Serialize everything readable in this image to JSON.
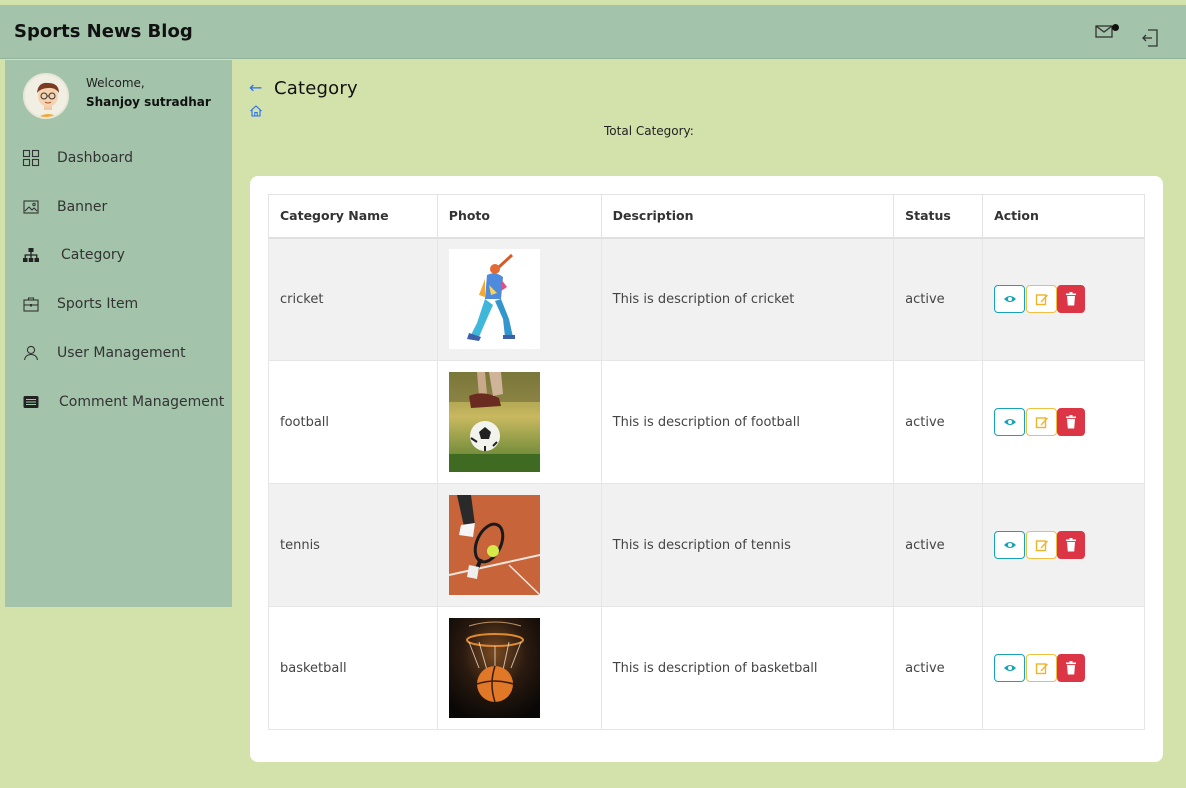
{
  "header": {
    "brand": "Sports News Blog",
    "icons": {
      "mail": "mail-icon",
      "notification": "notification-dot",
      "logout": "logout-icon"
    }
  },
  "sidebar": {
    "welcome": "Welcome,",
    "username": "Shanjoy sutradhar",
    "items": [
      {
        "label": "Dashboard",
        "icon": "dashboard-icon"
      },
      {
        "label": "Banner",
        "icon": "image-icon"
      },
      {
        "label": "Category",
        "icon": "sitemap-icon"
      },
      {
        "label": "Sports Item",
        "icon": "briefcase-icon"
      },
      {
        "label": "User Management",
        "icon": "user-icon"
      },
      {
        "label": "Comment Management",
        "icon": "list-icon"
      }
    ]
  },
  "main": {
    "title": "Category",
    "total_label": "Total Category:",
    "table": {
      "headers": [
        "Category Name",
        "Photo",
        "Description",
        "Status",
        "Action"
      ],
      "rows": [
        {
          "name": "cricket",
          "description": "This is description of cricket",
          "status": "active"
        },
        {
          "name": "football",
          "description": "This is description of football",
          "status": "active"
        },
        {
          "name": "tennis",
          "description": "This is description of tennis",
          "status": "active"
        },
        {
          "name": "basketball",
          "description": "This is description of basketball",
          "status": "active"
        }
      ]
    }
  },
  "colors": {
    "background": "#d3e2ab",
    "header": "#a3c4aa",
    "view": "#17a2b8",
    "edit": "#f0c040",
    "delete": "#dc3545"
  }
}
